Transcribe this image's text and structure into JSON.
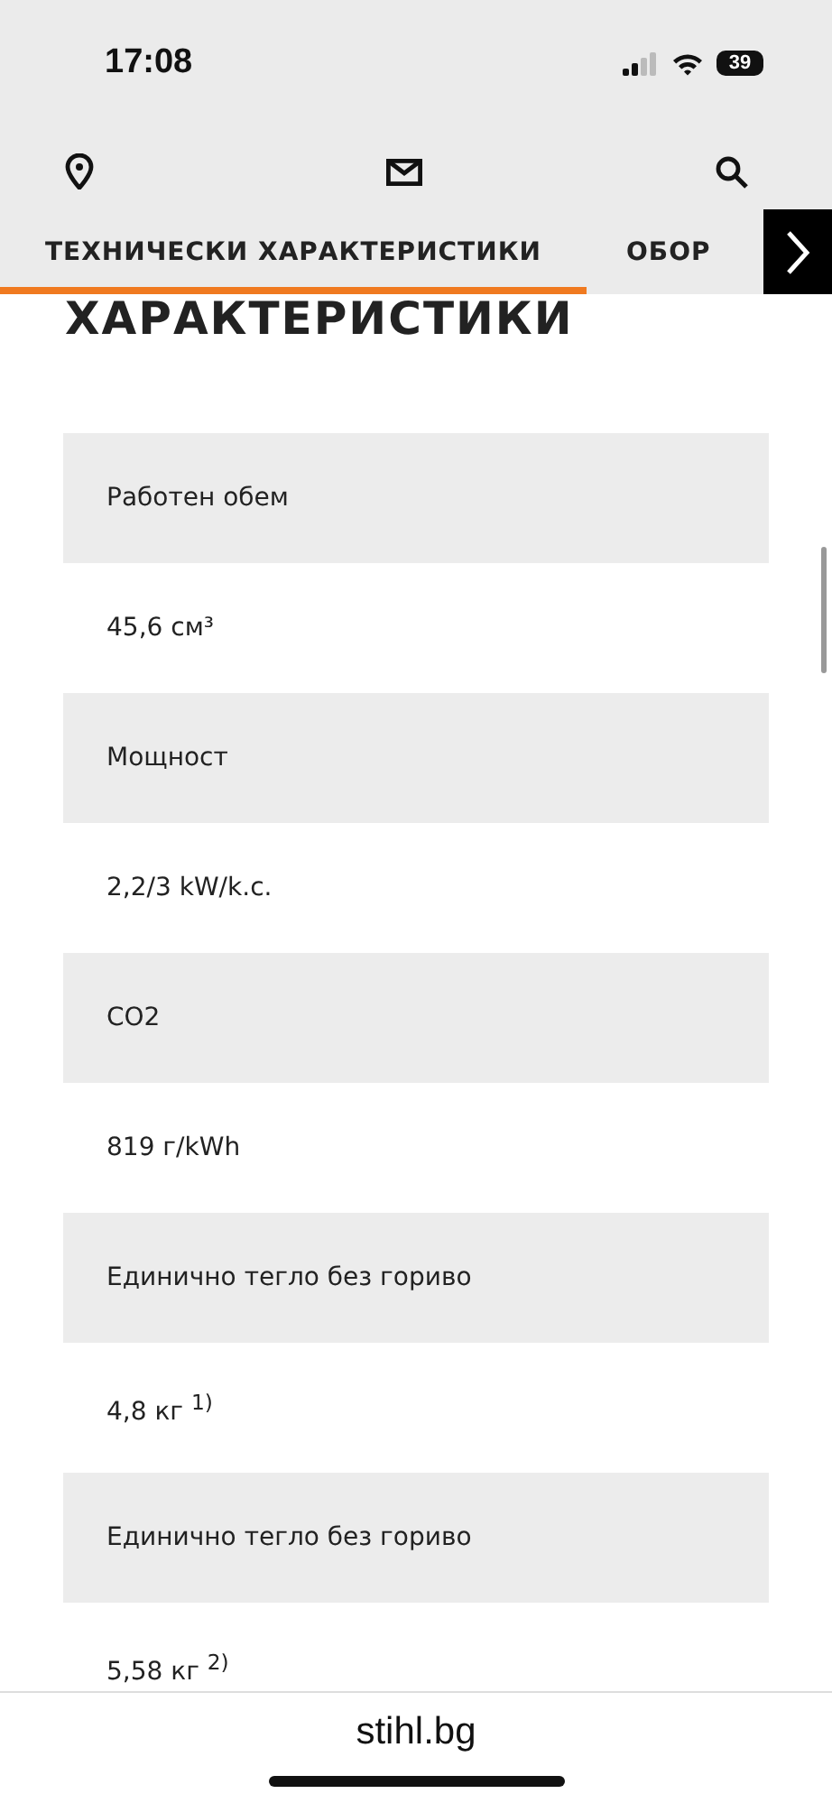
{
  "status_bar": {
    "time": "17:08",
    "battery": "39"
  },
  "tabs": [
    {
      "label": "ТЕХНИЧЕСКИ ХАРАКТЕРИСТИКИ",
      "selected": true
    },
    {
      "label": "ОБОР",
      "selected": false
    }
  ],
  "heading": "ХАРАКТЕРИСТИКИ",
  "specs": [
    {
      "label": "Работен обем",
      "value": "45,6 см³"
    },
    {
      "label": "Мощност",
      "value": "2,2/3 kW/k.c."
    },
    {
      "label": "CO2",
      "value": "819 г/kWh"
    },
    {
      "label": "Единично тегло без гориво",
      "value": "4,8 кг $^{1)}$"
    },
    {
      "label": "Единично тегло без гориво",
      "value": "5,58 кг $^{2)}$"
    }
  ],
  "address_bar": {
    "url": "stihl.bg"
  }
}
